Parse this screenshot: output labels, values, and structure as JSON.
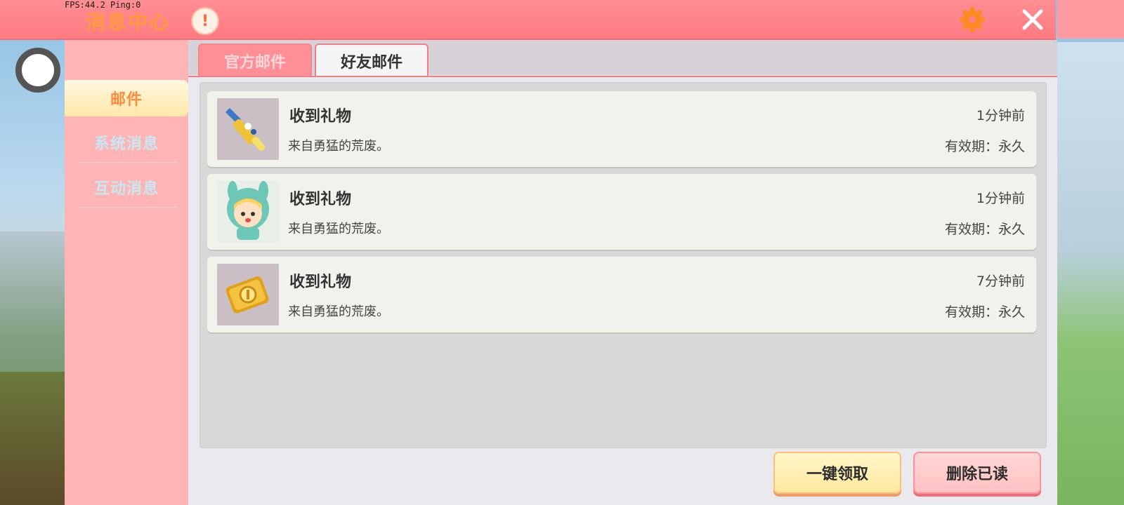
{
  "overlay": {
    "fps": "FPS:44.2  Ping:0"
  },
  "header": {
    "title": "消息中心"
  },
  "sidebar": {
    "items": [
      {
        "label": "邮件",
        "active": true
      },
      {
        "label": "系统消息",
        "active": false
      },
      {
        "label": "互动消息",
        "active": false
      }
    ]
  },
  "tabs": [
    {
      "label": "官方邮件",
      "active": false
    },
    {
      "label": "好友邮件",
      "active": true
    }
  ],
  "mails": [
    {
      "title": "收到礼物",
      "from": "来自勇猛的荒废。",
      "time": "1分钟前",
      "expire": "有效期：永久",
      "icon": "wrench-item-icon"
    },
    {
      "title": "收到礼物",
      "from": "来自勇猛的荒废。",
      "time": "1分钟前",
      "expire": "有效期：永久",
      "icon": "avatar-costume-icon"
    },
    {
      "title": "收到礼物",
      "from": "来自勇猛的荒废。",
      "time": "7分钟前",
      "expire": "有效期：永久",
      "icon": "gold-ticket-icon"
    }
  ],
  "buttons": {
    "claim_all": "一键领取",
    "delete_read": "删除已读"
  },
  "colors": {
    "header": "#ff8088",
    "sidebar": "#ffb4b6",
    "accent": "#ff8b3d"
  }
}
